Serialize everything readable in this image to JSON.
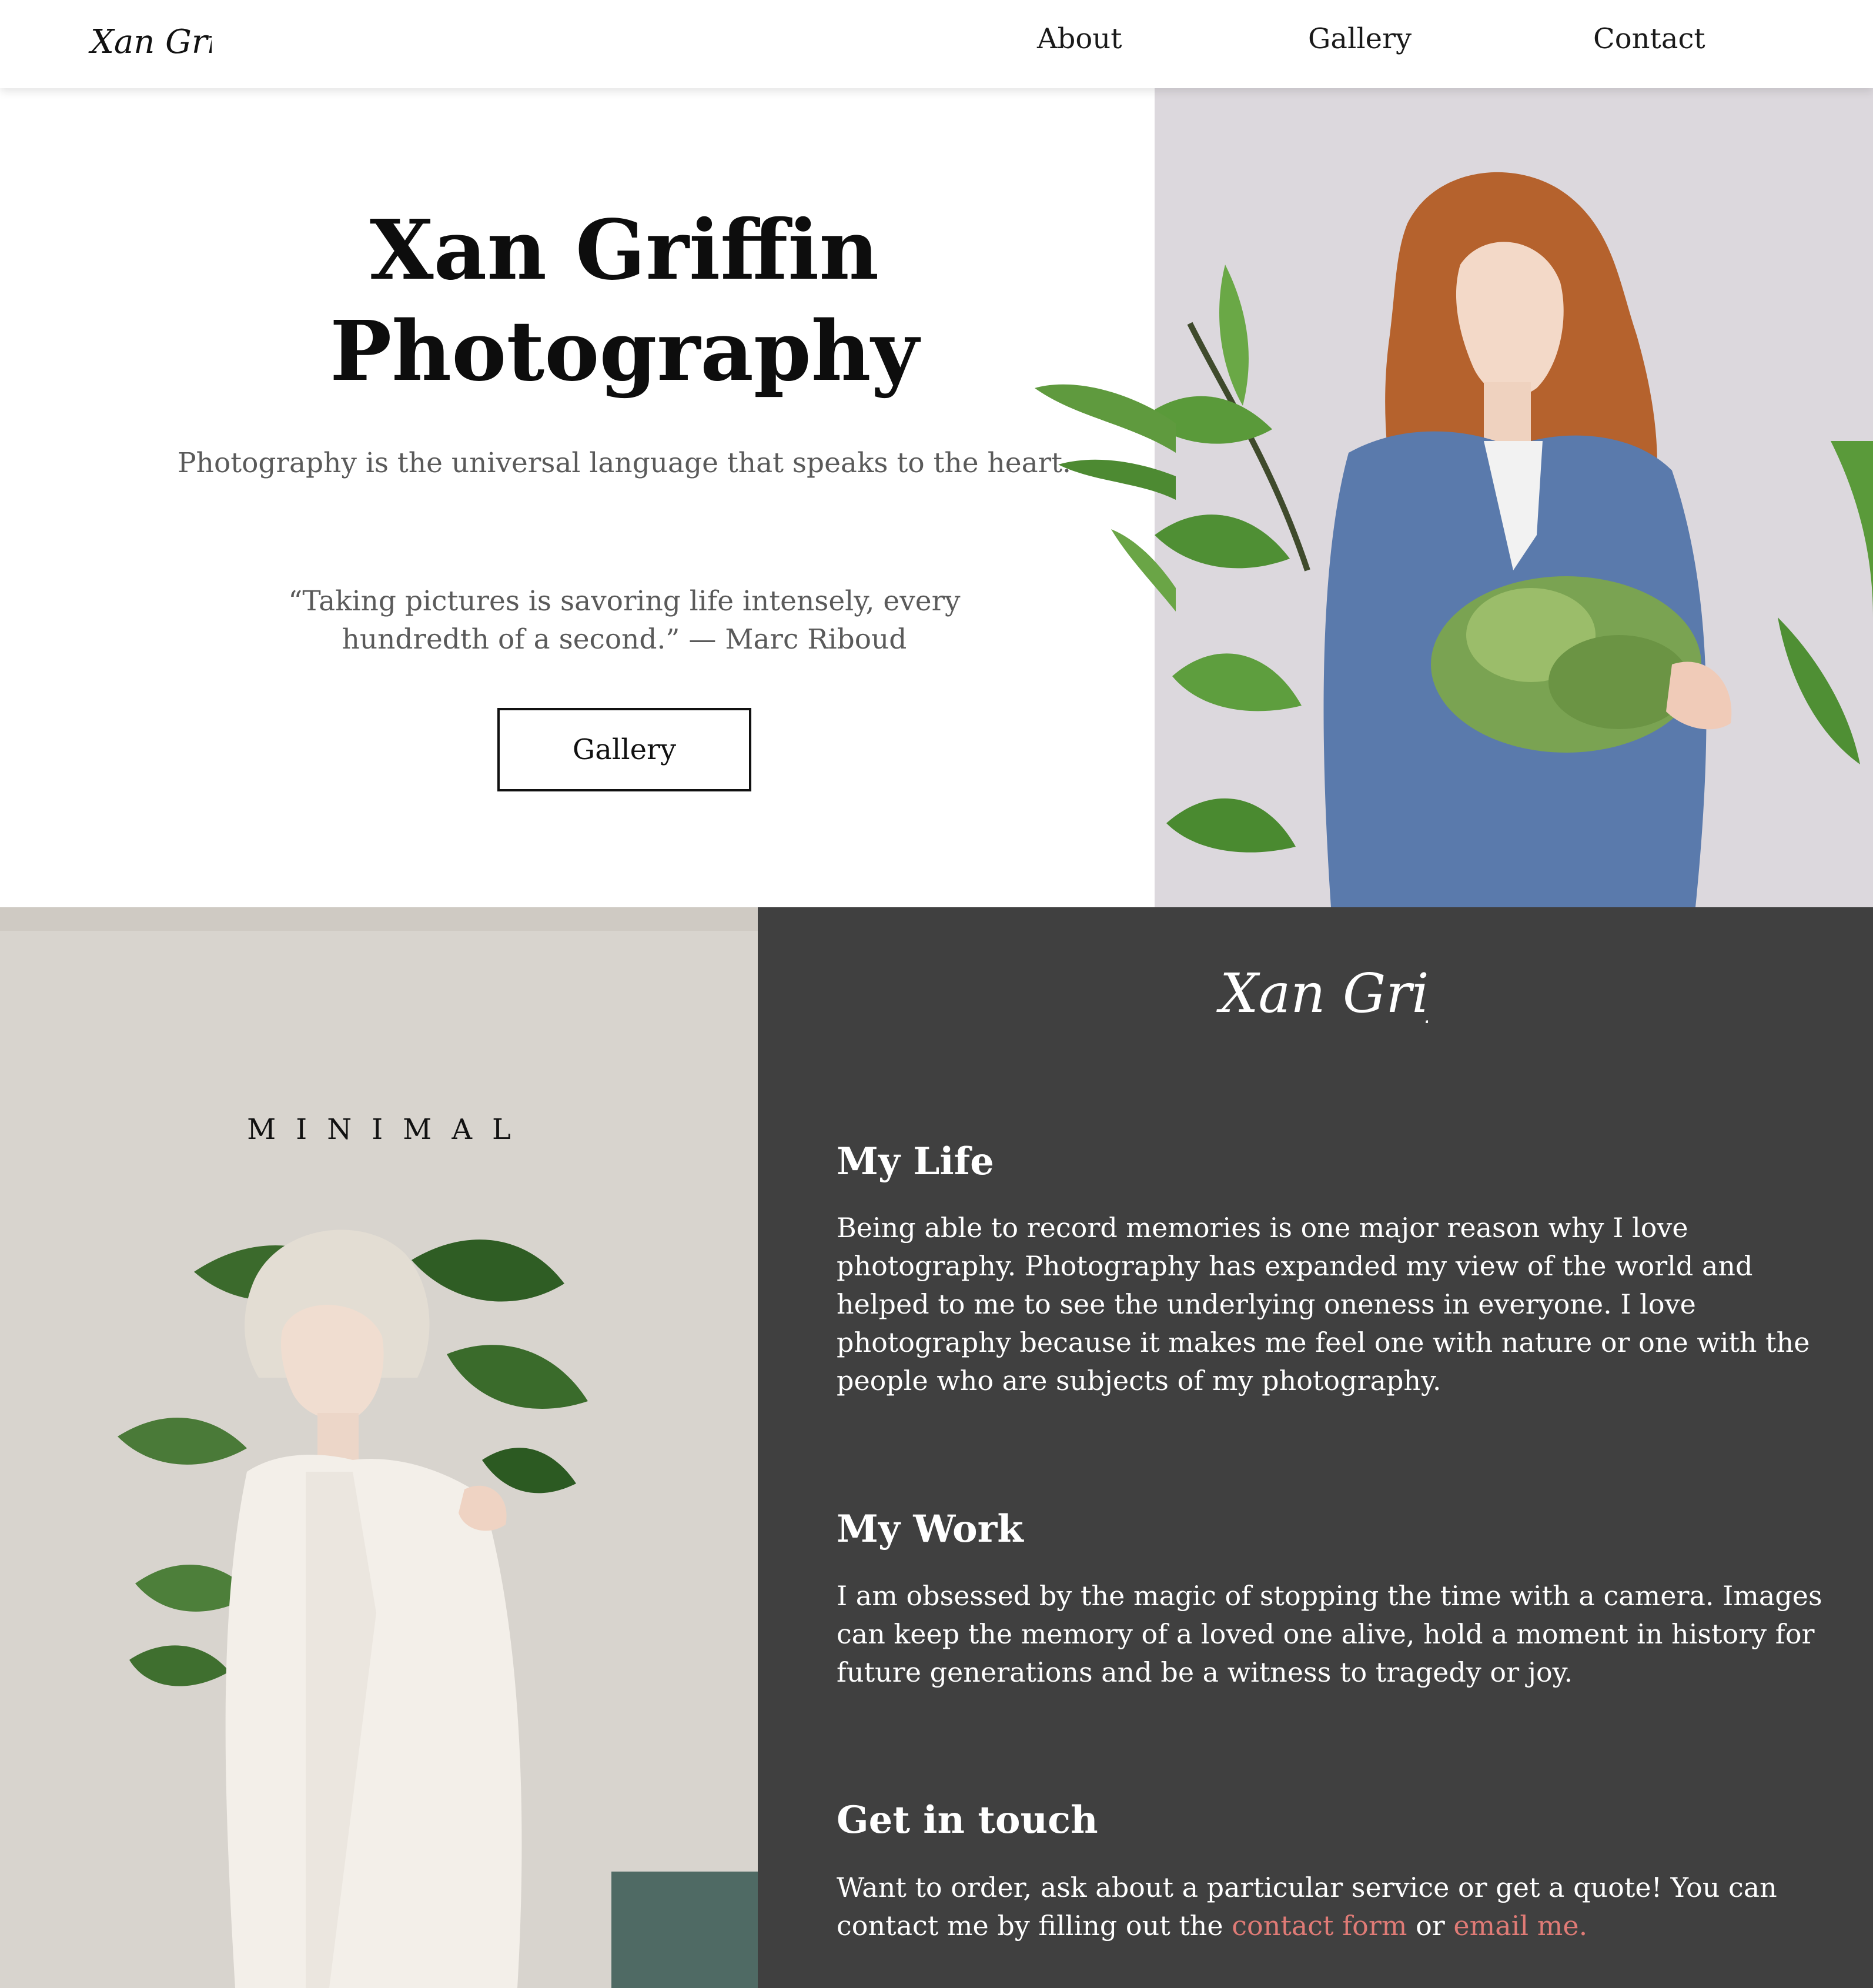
{
  "nav": {
    "brand": "Xan Griffin",
    "links": [
      "About",
      "Gallery",
      "Contact"
    ]
  },
  "hero": {
    "title_line1": "Xan Griffin",
    "title_line2": "Photography",
    "subtitle": "Photography is the universal language that speaks to the heart.",
    "quote": "“Taking pictures is savoring life intensely, every hundredth of a second.” — Marc Riboud",
    "button_label": "Gallery"
  },
  "feature": {
    "label": "MINIMAL"
  },
  "about": {
    "brand": "Xan Griffin",
    "sections": [
      {
        "heading": "My Life",
        "body": "Being able to record memories is one major reason why I love photography. Photography has expanded my view of the world and helped to me to see the underlying oneness in everyone. I love photography because it makes me feel one with nature or one with the people who are subjects of my photography."
      },
      {
        "heading": "My Work",
        "body": "I am obsessed by the magic of stopping the time with a camera. Images can keep the memory of a loved one alive, hold a moment in history for future generations and be a witness to tragedy or joy."
      },
      {
        "heading": "Get in touch",
        "body_before": "Want to order, ask about a particular service or get a quote! You can contact me by filling out the",
        "link1": "contact form",
        "between": "or",
        "link2": "email me."
      }
    ]
  },
  "colors": {
    "dark_panel": "#404040",
    "link_accent": "#e07b76",
    "hero_photo_bg": "#dcd8dd"
  }
}
